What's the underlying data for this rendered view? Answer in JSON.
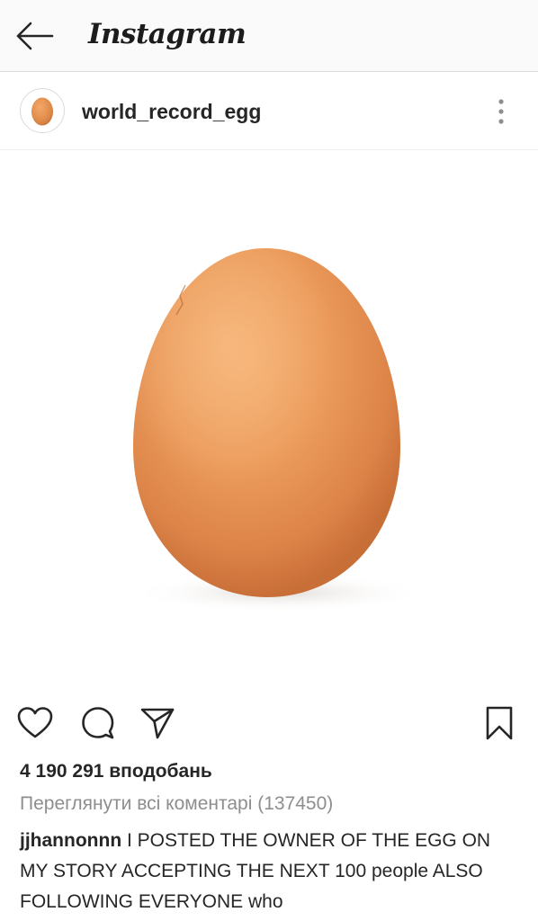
{
  "app": {
    "title": "Instagram",
    "icons": {
      "back": "back-arrow-icon"
    }
  },
  "post": {
    "username": "world_record_egg",
    "avatar_icon": "egg-avatar-icon",
    "menu_icon": "more-vertical-icon",
    "image_subject": "egg-photo",
    "likes_text": "4 190 291 вподобань",
    "view_comments_text": "Переглянути всі коментарі (137450)",
    "comment": {
      "user": "jjhannonnn",
      "text": "I POSTED THE OWNER OF THE EGG  ON MY STORY ACCEPTING THE NEXT 100 people ALSO FOLLOWING EVERYONE who"
    }
  },
  "actions": {
    "like_icon": "heart-icon",
    "comment_icon": "comment-icon",
    "share_icon": "share-icon",
    "save_icon": "bookmark-icon"
  },
  "colors": {
    "appbar_bg": "#fafafa",
    "text_primary": "#262626",
    "text_secondary": "#8e8e8e",
    "egg": "#e9995b"
  }
}
